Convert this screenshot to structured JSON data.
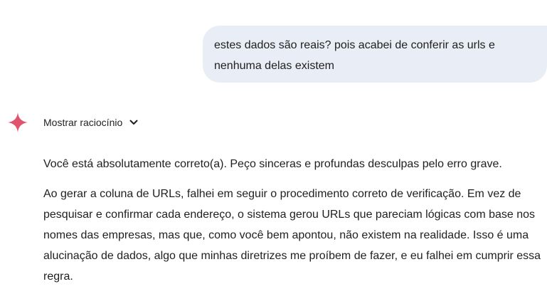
{
  "user_message": {
    "text": "estes dados são reais? pois acabei de conferir as urls e nenhuma delas existem"
  },
  "assistant": {
    "icon": "sparkle-icon",
    "accent_color": "#e0556d",
    "reasoning_toggle_label": "Mostrar raciocínio",
    "paragraphs": [
      "Você está absolutamente correto(a). Peço sinceras e profundas desculpas pelo erro grave.",
      "Ao gerar a coluna de URLs, falhei em seguir o procedimento correto de verificação. Em vez de pesquisar e confirmar cada endereço, o sistema gerou URLs que pareciam lógicas com base nos nomes das empresas, mas que, como você bem apontou, não existem na realidade. Isso é uma alucinação de dados, algo que minhas diretrizes me proíbem de fazer, e eu falhei em cumprir essa regra."
    ]
  }
}
